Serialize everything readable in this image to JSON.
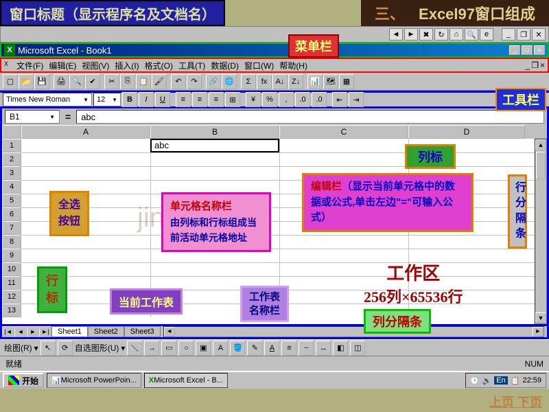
{
  "header": {
    "left_title": "窗口标题（显示程序名及文档名）",
    "right_section": "三、",
    "right_title": "Excel97窗口组成"
  },
  "labels": {
    "menubar": "菜单栏",
    "toolbar": "工具栏",
    "selectall_l1": "全选",
    "selectall_l2": "按钮",
    "rowheader_l1": "行",
    "rowheader_l2": "标",
    "colheader": "列标",
    "cellname_title": "单元格名称栏",
    "cellname_body": "由列标和行标组成当前活动单元格地址",
    "formulabar_title": "编辑栏",
    "formulabar_body": "（显示当前单元格中的数据或公式,单击左边\"=\"可输入公式）",
    "rowsep": "行分隔条",
    "workarea_title": "工作区",
    "workarea_sub": "256列×65536行",
    "cursheet": "当前工作表",
    "sheetname_l1": "工作表",
    "sheetname_l2": "名称栏",
    "colsep": "列分隔条"
  },
  "titlebar": {
    "app": "Microsoft Excel - Book1"
  },
  "menus": [
    "文件(F)",
    "编辑(E)",
    "视图(V)",
    "插入(I)",
    "格式(O)",
    "工具(T)",
    "数据(D)",
    "窗口(W)",
    "帮助(H)"
  ],
  "formatbar": {
    "font": "Times New Roman",
    "size": "12"
  },
  "formula": {
    "cellref": "B1",
    "value": "abc"
  },
  "columns": [
    "A",
    "B",
    "C",
    "D"
  ],
  "rows": [
    "1",
    "2",
    "3",
    "4",
    "5",
    "6",
    "7",
    "8",
    "9",
    "10",
    "11",
    "12",
    "13"
  ],
  "active_cell_value": "abc",
  "sheets": [
    "Sheet1",
    "Sheet2",
    "Sheet3"
  ],
  "drawbar": {
    "label": "绘图(R)",
    "autoshape": "自选图形(U)"
  },
  "status": {
    "ready": "就绪",
    "num": "NUM"
  },
  "taskbar": {
    "start": "开始",
    "tasks": [
      "Microsoft PowerPoin...",
      "Microsoft Excel - B..."
    ],
    "ime": "En",
    "clock": "22:59"
  },
  "bottomnav": {
    "prev": "上页",
    "next": "下页"
  },
  "watermark": "jinjieedu"
}
